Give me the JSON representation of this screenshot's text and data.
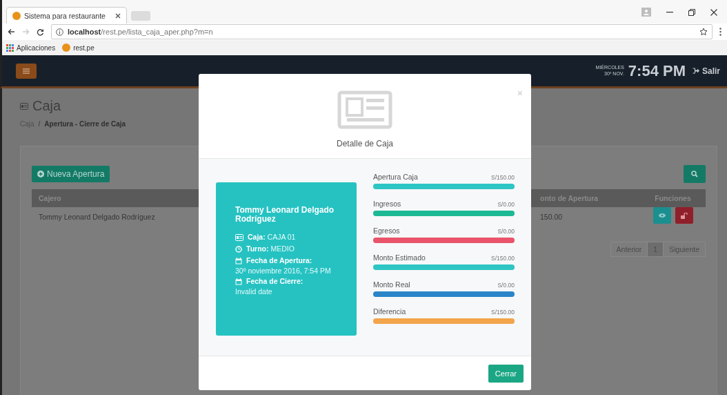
{
  "browser": {
    "tab_title": "Sistema para restaurante",
    "address": "**localhost**/rest.pe/lista_caja_aper.php?m=n",
    "bookmarks": [
      "Aplicaciones",
      "rest.pe"
    ]
  },
  "header": {
    "day": "MIÉRCOLES",
    "date": "30º NOV.",
    "time": "7:54 PM",
    "logout": "Salir"
  },
  "page": {
    "title": "Caja",
    "breadcrumb": [
      "Caja",
      "Apertura - Cierre de Caja"
    ],
    "separator": "/"
  },
  "toolbar": {
    "new_button": "Nueva Apertura"
  },
  "table": {
    "columns": [
      "Cajero",
      "onto de Apertura",
      "Funciones"
    ],
    "rows": [
      {
        "cajero": "Tommy Leonard Delgado Rodríguez",
        "monto": "150.00"
      }
    ]
  },
  "pagination": [
    {
      "label": "Anterior",
      "selected": false
    },
    {
      "label": "1",
      "selected": true
    },
    {
      "label": "Siguiente",
      "selected": false
    }
  ],
  "modal": {
    "title": "Detalle de Caja",
    "close": "×",
    "button": "Cerrar",
    "card": {
      "name": "Tommy Leonard Delgado Rodríguez",
      "items": [
        {
          "kind": "inline",
          "text": "**Caja:** CAJA 01"
        },
        {
          "kind": "inline",
          "text": "**Turno:** MEDIO"
        },
        {
          "kind": "block",
          "label": "Fecha de Apertura:",
          "value": "30º noviembre 2016, 7:54 PM"
        },
        {
          "kind": "block",
          "label": "Fecha de Cierre:",
          "value": "Invalid date"
        }
      ]
    },
    "bars": [
      {
        "label": "Apertura Caja",
        "amount": "S/150.00",
        "color": "#2dc6c4",
        "level": 1
      },
      {
        "label": "Ingresos",
        "amount": "S/0.00",
        "color": "#1db994",
        "level": 1
      },
      {
        "label": "Egresos",
        "amount": "S/0.00",
        "color": "#e9546b",
        "level": 1
      },
      {
        "label": "Monto Estimado",
        "amount": "S/150.00",
        "color": "#2dc6c4",
        "level": 1
      },
      {
        "label": "Monto Real",
        "amount": "S/0.00",
        "color": "#2a86c8",
        "level": 1
      },
      {
        "label": "Diferencia",
        "amount": "S/150.00",
        "color": "#f2a54a",
        "level": 1
      }
    ]
  }
}
